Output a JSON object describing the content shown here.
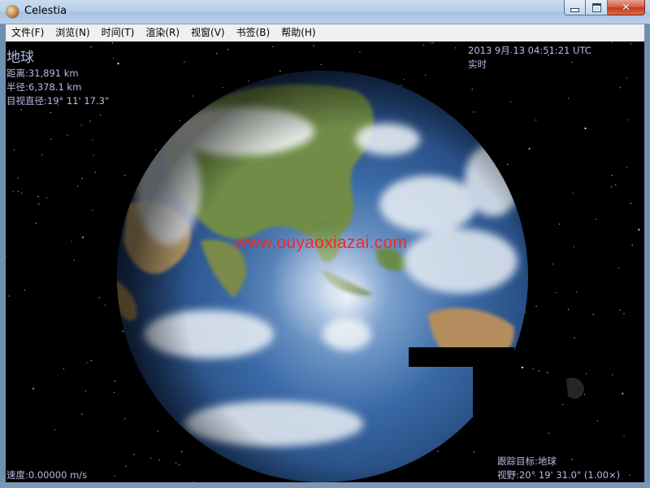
{
  "window": {
    "title": "Celestia",
    "icon": "celestia-app-icon",
    "controls": {
      "minimize": "minimize-icon",
      "maximize": "maximize-icon",
      "close": "close-icon"
    }
  },
  "menu": {
    "items": [
      {
        "label": "文件(F)"
      },
      {
        "label": "浏览(N)"
      },
      {
        "label": "时间(T)"
      },
      {
        "label": "渲染(R)"
      },
      {
        "label": "视窗(V)"
      },
      {
        "label": "书签(B)"
      },
      {
        "label": "帮助(H)"
      }
    ]
  },
  "hud": {
    "target_name": "地球",
    "distance": "距离:31,891 km",
    "radius": "半径:6,378.1 km",
    "apparent_diameter": "目视直径:19° 11' 17.3\"",
    "datetime": "2013 9月 13 04:51:21 UTC",
    "time_mode": "实时",
    "speed": "速度:0.00000 m/s",
    "tracking": "跟踪目标:地球",
    "fov": "视野:20° 19' 31.0\" (1.00×)"
  },
  "watermark": "www.ouyaoxiazai.com",
  "colors": {
    "hud_text": "#b7bbe6",
    "watermark": "#ee2a2a",
    "space": "#000000",
    "ocean": "#2f5f9e",
    "land": "#6e8a45",
    "desert": "#b79c6a",
    "cloud": "#e8eef5"
  }
}
